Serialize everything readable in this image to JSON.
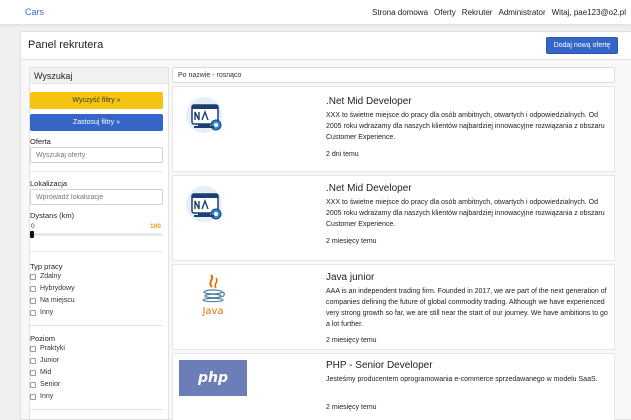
{
  "nav": {
    "brand": "Cars",
    "links": [
      "Strona domowa",
      "Oferty",
      "Rekruter",
      "Administrator",
      "Witaj, pae123@o2.pl"
    ]
  },
  "header": {
    "title": "Panel rekrutera",
    "add_button": "Dodaj nową ofertę"
  },
  "sidebar": {
    "title": "Wyszukaj",
    "clear_button": "Wyczyść filtry »",
    "apply_button": "Zastosuj filtry »",
    "offer_label": "Oferta",
    "offer_placeholder": "Wyszukaj oferty",
    "location_label": "Lokalizacja",
    "location_placeholder": "Wprowadź lokalizacje",
    "distance_label": "Dystans (km)",
    "distance_min": "0",
    "distance_max": "100",
    "distance_value": 0,
    "work_type_label": "Typ pracy",
    "work_types": [
      "Zdalny",
      "Hybrydowy",
      "Na miejscu",
      "Inny"
    ],
    "level_label": "Poziom",
    "levels": [
      "Praktyki",
      "Junior",
      "Mid",
      "Senior",
      "Inny"
    ]
  },
  "sort": {
    "value": "Po nazwie - rosnąco"
  },
  "offers": [
    {
      "title": ".Net Mid Developer",
      "description": "XXX to świetne miejsce do pracy dla osób ambitnych, otwartych i odpowiedzialnych. Od 2005 roku wdrażamy dla naszych klientów najbardziej innowacyjne rozwiązania z obszaru Customer Experience.",
      "time": "2 dni temu",
      "logo": "dotnet-logo"
    },
    {
      "title": ".Net Mid Developer",
      "description": "XXX to świetne miejsce do pracy dla osób ambitnych, otwartych i odpowiedzialnych. Od 2005 roku wdrażamy dla naszych klientów najbardziej innowacyjne rozwiązania z obszaru Customer Experience.",
      "time": "2 miesięcy temu",
      "logo": "dotnet-logo"
    },
    {
      "title": "Java junior",
      "description": "AAA is an independent trading firm. Founded in 2017, we are part of the next generation of companies defining the future of global commodity trading. Although we have experienced very strong growth so far, we are still near the start of our journey. We have ambitions to go a lot further.",
      "time": "2 miesięcy temu",
      "logo": "java-logo",
      "logo_text": "Java"
    },
    {
      "title": "PHP - Senior Developer",
      "description": "Jesteśmy producentem oprogramowania e-commerce sprzedawanego w modelu SaaS.",
      "time": "2 miesięcy temu",
      "logo": "php-logo",
      "logo_text": "php"
    }
  ]
}
